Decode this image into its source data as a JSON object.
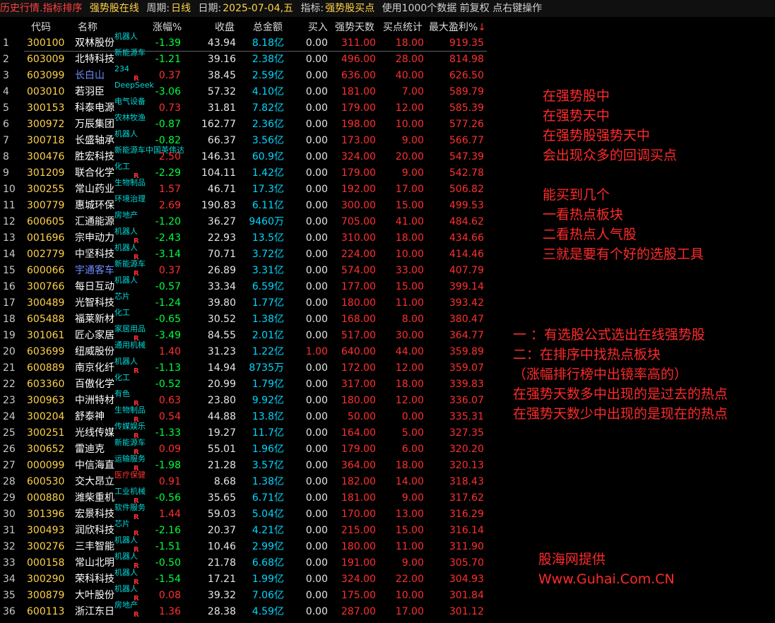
{
  "topbar": {
    "mode": "历史行情.指标排序",
    "scheme": "强势股在线",
    "period_label": "周期:",
    "period_value": "日线",
    "date_label": "日期:",
    "date_value": "2025-07-04,五",
    "indicator_label": "指标:",
    "indicator_value": "强势股买点",
    "info": "使用1000个数据 前复权 点右键操作"
  },
  "columns": {
    "code": "代码",
    "name": "名称",
    "change": "涨幅%",
    "close": "收盘",
    "amount": "总金额",
    "buy": "买入",
    "strong_days": "强势天数",
    "buy_stats": "买点统计",
    "max_profit": "最大盈利%",
    "sort_mark": "↓"
  },
  "rows": [
    {
      "idx": "1",
      "code": "300100",
      "name": "双林股份",
      "tag": "机器人",
      "r": "",
      "change": "-1.39",
      "close": "43.94",
      "amount": "8.18亿",
      "buy": "0.00",
      "days": "311.00",
      "pts": "18.00",
      "max": "919.35"
    },
    {
      "idx": "2",
      "code": "603009",
      "name": "北特科技",
      "tag": "新能源车",
      "r": "",
      "change": "-1.21",
      "close": "39.16",
      "amount": "2.38亿",
      "buy": "0.00",
      "days": "496.00",
      "pts": "28.00",
      "max": "814.98"
    },
    {
      "idx": "3",
      "code": "603099",
      "name": "长白山",
      "tag": "234",
      "r": "R",
      "change": "0.37",
      "close": "38.45",
      "amount": "2.59亿",
      "buy": "0.00",
      "days": "636.00",
      "pts": "40.00",
      "max": "626.50",
      "name_color": "blue"
    },
    {
      "idx": "4",
      "code": "003010",
      "name": "若羽臣",
      "tag": "DeepSeek",
      "r": "",
      "change": "-3.06",
      "close": "57.32",
      "amount": "4.10亿",
      "buy": "0.00",
      "days": "181.00",
      "pts": "7.00",
      "max": "589.79"
    },
    {
      "idx": "5",
      "code": "300153",
      "name": "科泰电源",
      "tag": "电气设备",
      "r": "",
      "change": "0.73",
      "close": "31.81",
      "amount": "7.82亿",
      "buy": "0.00",
      "days": "179.00",
      "pts": "12.00",
      "max": "585.39"
    },
    {
      "idx": "6",
      "code": "300972",
      "name": "万辰集团",
      "tag": "农林牧渔",
      "r": "",
      "change": "-0.87",
      "close": "162.77",
      "amount": "2.36亿",
      "buy": "0.00",
      "days": "198.00",
      "pts": "10.00",
      "max": "577.26"
    },
    {
      "idx": "7",
      "code": "300718",
      "name": "长盛轴承",
      "tag": "机器人",
      "r": "",
      "change": "-0.82",
      "close": "66.37",
      "amount": "3.56亿",
      "buy": "0.00",
      "days": "173.00",
      "pts": "9.00",
      "max": "566.77"
    },
    {
      "idx": "8",
      "code": "300476",
      "name": "胜宏科技",
      "tag": "新能源车中国英伟达",
      "r": "",
      "change": "2.50",
      "close": "146.31",
      "amount": "60.9亿",
      "buy": "0.00",
      "days": "324.00",
      "pts": "20.00",
      "max": "547.39"
    },
    {
      "idx": "9",
      "code": "301209",
      "name": "联合化学",
      "tag": "化工",
      "r": "R",
      "change": "-2.29",
      "close": "104.11",
      "amount": "1.42亿",
      "buy": "0.00",
      "days": "179.00",
      "pts": "9.00",
      "max": "542.78"
    },
    {
      "idx": "10",
      "code": "300255",
      "name": "常山药业",
      "tag": "生物制品",
      "r": "",
      "change": "1.57",
      "close": "46.71",
      "amount": "17.3亿",
      "buy": "0.00",
      "days": "192.00",
      "pts": "17.00",
      "max": "506.82"
    },
    {
      "idx": "11",
      "code": "300779",
      "name": "惠城环保",
      "tag": "环境治理",
      "r": "",
      "change": "2.69",
      "close": "190.83",
      "amount": "6.11亿",
      "buy": "0.00",
      "days": "300.00",
      "pts": "15.00",
      "max": "499.53"
    },
    {
      "idx": "12",
      "code": "600605",
      "name": "汇通能源",
      "tag": "房地产",
      "r": "",
      "change": "-1.20",
      "close": "36.27",
      "amount": "9460万",
      "buy": "0.00",
      "days": "705.00",
      "pts": "41.00",
      "max": "484.62"
    },
    {
      "idx": "13",
      "code": "001696",
      "name": "宗申动力",
      "tag": "机器人",
      "r": "R",
      "change": "-2.43",
      "close": "22.93",
      "amount": "13.5亿",
      "buy": "0.00",
      "days": "310.00",
      "pts": "18.00",
      "max": "434.66"
    },
    {
      "idx": "14",
      "code": "002779",
      "name": "中坚科技",
      "tag": "机器人",
      "r": "R",
      "change": "-3.14",
      "close": "70.71",
      "amount": "3.72亿",
      "buy": "0.00",
      "days": "224.00",
      "pts": "10.00",
      "max": "414.46"
    },
    {
      "idx": "15",
      "code": "600066",
      "name": "宇通客车",
      "tag": "新能源车",
      "r": "R",
      "change": "0.37",
      "close": "26.89",
      "amount": "3.31亿",
      "buy": "0.00",
      "days": "574.00",
      "pts": "33.00",
      "max": "407.79",
      "name_color": "blue"
    },
    {
      "idx": "16",
      "code": "300766",
      "name": "每日互动",
      "tag": "机器人",
      "r": "",
      "change": "-0.57",
      "close": "33.34",
      "amount": "6.59亿",
      "buy": "0.00",
      "days": "177.00",
      "pts": "15.00",
      "max": "399.14"
    },
    {
      "idx": "17",
      "code": "300489",
      "name": "光智科技",
      "tag": "芯片",
      "r": "",
      "change": "-1.24",
      "close": "39.80",
      "amount": "1.77亿",
      "buy": "0.00",
      "days": "180.00",
      "pts": "11.00",
      "max": "393.42"
    },
    {
      "idx": "18",
      "code": "605488",
      "name": "福莱新材",
      "tag": "化工",
      "r": "",
      "change": "-0.65",
      "close": "30.52",
      "amount": "1.38亿",
      "buy": "0.00",
      "days": "168.00",
      "pts": "8.00",
      "max": "380.47"
    },
    {
      "idx": "19",
      "code": "301061",
      "name": "匠心家居",
      "tag": "家居用品",
      "r": "R",
      "change": "-3.49",
      "close": "84.55",
      "amount": "2.01亿",
      "buy": "0.00",
      "days": "517.00",
      "pts": "30.00",
      "max": "364.77"
    },
    {
      "idx": "20",
      "code": "603699",
      "name": "纽威股份",
      "tag": "通用机械",
      "r": "",
      "change": "1.40",
      "close": "31.23",
      "amount": "1.22亿",
      "buy": "1.00",
      "days": "640.00",
      "pts": "44.00",
      "max": "359.89",
      "buy_color": "red"
    },
    {
      "idx": "21",
      "code": "600889",
      "name": "南京化纤",
      "tag": "机器人",
      "r": "R",
      "change": "-1.13",
      "close": "14.94",
      "amount": "8735万",
      "buy": "0.00",
      "days": "172.00",
      "pts": "12.00",
      "max": "359.07"
    },
    {
      "idx": "22",
      "code": "603360",
      "name": "百傲化学",
      "tag": "化工",
      "r": "",
      "change": "-0.52",
      "close": "20.99",
      "amount": "1.79亿",
      "buy": "0.00",
      "days": "317.00",
      "pts": "18.00",
      "max": "339.83"
    },
    {
      "idx": "23",
      "code": "300963",
      "name": "中洲特材",
      "tag": "有色",
      "r": "R",
      "change": "0.63",
      "close": "23.80",
      "amount": "9.92亿",
      "buy": "0.00",
      "days": "180.00",
      "pts": "12.00",
      "max": "336.07"
    },
    {
      "idx": "24",
      "code": "300204",
      "name": "舒泰神",
      "tag": "生物制品",
      "r": "R",
      "change": "0.54",
      "close": "44.88",
      "amount": "13.8亿",
      "buy": "0.00",
      "days": "50.00",
      "pts": "0.00",
      "max": "335.31"
    },
    {
      "idx": "25",
      "code": "300251",
      "name": "光线传媒",
      "tag": "传媒娱乐",
      "r": "R",
      "change": "-1.33",
      "close": "19.27",
      "amount": "11.7亿",
      "buy": "0.00",
      "days": "164.00",
      "pts": "5.00",
      "max": "327.35"
    },
    {
      "idx": "26",
      "code": "300652",
      "name": "雷迪克",
      "tag": "新能源车",
      "r": "R",
      "change": "0.09",
      "close": "55.01",
      "amount": "1.96亿",
      "buy": "0.00",
      "days": "179.00",
      "pts": "6.00",
      "max": "320.20"
    },
    {
      "idx": "27",
      "code": "000099",
      "name": "中信海直",
      "tag": "运输服务",
      "r": "R",
      "change": "-1.98",
      "close": "21.28",
      "amount": "3.57亿",
      "buy": "0.00",
      "days": "364.00",
      "pts": "18.00",
      "max": "320.13"
    },
    {
      "idx": "28",
      "code": "600530",
      "name": "交大昂立",
      "tag": "医疗保健",
      "r": "",
      "change": "0.91",
      "close": "8.68",
      "amount": "1.38亿",
      "buy": "0.00",
      "days": "182.00",
      "pts": "14.00",
      "max": "318.43",
      "tag_color": "red"
    },
    {
      "idx": "29",
      "code": "000880",
      "name": "潍柴重机",
      "tag": "工业机械",
      "r": "R",
      "change": "-0.56",
      "close": "35.65",
      "amount": "6.71亿",
      "buy": "0.00",
      "days": "181.00",
      "pts": "9.00",
      "max": "317.62"
    },
    {
      "idx": "30",
      "code": "301396",
      "name": "宏景科技",
      "tag": "软件服务",
      "r": "R",
      "change": "1.44",
      "close": "59.03",
      "amount": "5.04亿",
      "buy": "0.00",
      "days": "170.00",
      "pts": "13.00",
      "max": "316.29"
    },
    {
      "idx": "31",
      "code": "300493",
      "name": "润欣科技",
      "tag": "芯片",
      "r": "R",
      "change": "-2.16",
      "close": "20.37",
      "amount": "4.21亿",
      "buy": "0.00",
      "days": "215.00",
      "pts": "15.00",
      "max": "316.14"
    },
    {
      "idx": "32",
      "code": "300276",
      "name": "三丰智能",
      "tag": "机器人",
      "r": "R",
      "change": "-1.51",
      "close": "10.46",
      "amount": "2.99亿",
      "buy": "0.00",
      "days": "180.00",
      "pts": "11.00",
      "max": "311.90"
    },
    {
      "idx": "33",
      "code": "000158",
      "name": "常山北明",
      "tag": "机器人",
      "r": "R",
      "change": "-0.50",
      "close": "21.78",
      "amount": "6.68亿",
      "buy": "0.00",
      "days": "191.00",
      "pts": "9.00",
      "max": "305.70"
    },
    {
      "idx": "34",
      "code": "300290",
      "name": "荣科科技",
      "tag": "机器人",
      "r": "R",
      "change": "-1.54",
      "close": "17.21",
      "amount": "1.99亿",
      "buy": "0.00",
      "days": "324.00",
      "pts": "22.00",
      "max": "304.93"
    },
    {
      "idx": "35",
      "code": "300879",
      "name": "大叶股份",
      "tag": "机器人",
      "r": "R",
      "change": "0.08",
      "close": "39.32",
      "amount": "7.06亿",
      "buy": "0.00",
      "days": "175.00",
      "pts": "10.00",
      "max": "301.84"
    },
    {
      "idx": "36",
      "code": "600113",
      "name": "浙江东日",
      "tag": "房地产",
      "r": "R",
      "change": "1.36",
      "close": "28.38",
      "amount": "4.59亿",
      "buy": "0.00",
      "days": "287.00",
      "pts": "17.00",
      "max": "301.12"
    }
  ],
  "notes": {
    "block1": [
      "在强势股中",
      "在强势天中",
      "在强势股强势天中",
      "会出现众多的回调买点"
    ],
    "block2": [
      "能买到几个",
      "一看热点板块",
      "二看热点人气股",
      "三就是要有个好的选股工具"
    ],
    "block3": [
      "一 ：有选股公式选出在线强势股",
      "二：在排序中找热点板块",
      "（涨幅排行榜中出镜率高的）",
      "在强势天数多中出现的是过去的热点",
      "在强势天数少中出现的是现在的热点"
    ],
    "credit": [
      "股海网提供",
      "Www.Guhai.Com.CN"
    ]
  },
  "colors": {
    "up": "#ff3030",
    "down": "#00ff3c",
    "code": "#ffd24a",
    "amount": "#00d8ff",
    "tag": "#00d8d8",
    "note": "#ff2a2a",
    "background": "#000000"
  }
}
